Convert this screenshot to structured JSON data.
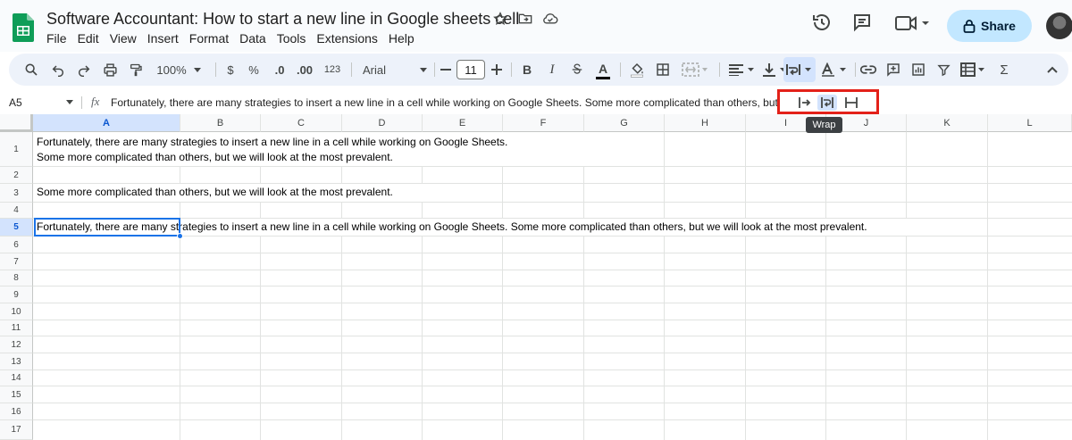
{
  "document": {
    "title": "Software Accountant: How to start a new line in Google sheets cell"
  },
  "menu": [
    "File",
    "Edit",
    "View",
    "Insert",
    "Format",
    "Data",
    "Tools",
    "Extensions",
    "Help"
  ],
  "header": {
    "share_label": "Share"
  },
  "toolbar": {
    "zoom": "100%",
    "currency": "$",
    "percent": "%",
    "decrease_decimal": ".0",
    "increase_decimal": ".00",
    "number_format": "123",
    "font": "Arial",
    "font_size": "11",
    "bold": "B",
    "italic": "I",
    "text_color": "A",
    "sum": "Σ"
  },
  "formula_bar": {
    "name_box": "A5",
    "fx": "fx",
    "content": "Fortunately, there are many strategies to insert a new line in a cell while working on Google Sheets. Some more complicated than others, but we will look at the most prevalent.",
    "trailing": "."
  },
  "wrap_popup": {
    "options": [
      "overflow",
      "wrap",
      "clip"
    ],
    "selected": "wrap",
    "tooltip": "Wrap"
  },
  "grid": {
    "columns": [
      "A",
      "B",
      "C",
      "D",
      "E",
      "F",
      "G",
      "H",
      "I",
      "J",
      "K",
      "L"
    ],
    "selected_column": "A",
    "rows": [
      "1",
      "2",
      "3",
      "4",
      "5",
      "6",
      "7",
      "8",
      "9",
      "10",
      "11",
      "12",
      "13",
      "14",
      "15",
      "16",
      "17"
    ],
    "selected_row": "5",
    "cells": {
      "A1_line1": "Fortunately, there are many strategies to insert a new line in a cell while working on Google Sheets.",
      "A1_line2": "Some more complicated than others, but we will look at the most prevalent.",
      "A3": "Some more complicated than others, but we will look at the most prevalent.",
      "A5": "Fortunately, there are many strategies to insert a new line in a cell while working on Google Sheets. Some more complicated than others, but we will look at the most prevalent."
    }
  },
  "colors": {
    "accent": "#1a73e8",
    "share_bg": "#c2e7ff",
    "toolbar_bg": "#edf2fa",
    "highlight_box": "#e32119",
    "sheets_green": "#0f9d58"
  }
}
